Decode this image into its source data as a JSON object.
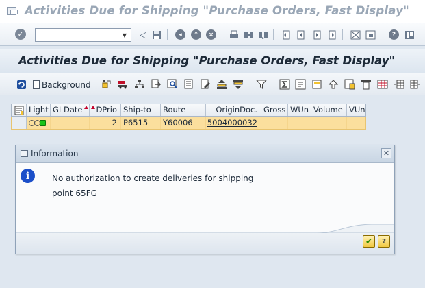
{
  "window": {
    "title": "Activities Due for Shipping \"Purchase Orders, Fast Display\""
  },
  "system_toolbar": {
    "command_field_value": "",
    "command_field_placeholder": "",
    "icons": [
      "enter-icon",
      "back-icon",
      "save-icon",
      "back-nav-icon",
      "exit-icon",
      "cancel-icon",
      "print-icon",
      "find-icon",
      "find-next-icon",
      "first-page-icon",
      "prev-page-icon",
      "next-page-icon",
      "last-page-icon",
      "layout-icon",
      "new-session-icon",
      "help-icon",
      "customize-icon"
    ]
  },
  "screen": {
    "title": "Activities Due for Shipping \"Purchase Orders, Fast Display\""
  },
  "app_toolbar": {
    "background_label": "Background"
  },
  "grid": {
    "columns": [
      "Light",
      "GI Date",
      "DPrio",
      "Ship-to",
      "Route",
      "OriginDoc.",
      "Gross",
      "WUn",
      "Volume",
      "VUn"
    ],
    "rows": [
      {
        "light": "green",
        "gi_date": "",
        "dprio": "2",
        "ship_to": "P6515",
        "route": "Y60006",
        "origin_doc": "5004000032",
        "gross": "",
        "wun": "",
        "volume": "",
        "vun": ""
      }
    ]
  },
  "dialog": {
    "title": "Information",
    "message_line1": "No authorization to create deliveries for shipping",
    "message_line2": "point 65FG",
    "ok_label": "✔",
    "help_label": "?"
  },
  "colors": {
    "row_highlight": "#fbdf9d",
    "info_blue": "#1b4fc9",
    "sort_red": "#c4002a"
  }
}
